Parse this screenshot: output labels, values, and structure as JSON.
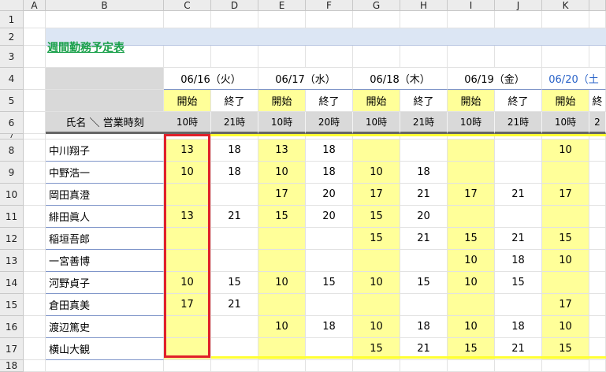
{
  "columns": [
    "A",
    "B",
    "C",
    "D",
    "E",
    "F",
    "G",
    "H",
    "I",
    "J",
    "K",
    ""
  ],
  "rows": [
    "1",
    "2",
    "3",
    "4",
    "5",
    "6",
    "7",
    "8",
    "9",
    "10",
    "11",
    "12",
    "13",
    "14",
    "15",
    "16",
    "17",
    "18"
  ],
  "title": "週間勤務予定表",
  "header": {
    "name_label": "氏名 ＼ 営業時刻",
    "dates": [
      {
        "label": "06/16（火）"
      },
      {
        "label": "06/17（水）"
      },
      {
        "label": "06/18（木）"
      },
      {
        "label": "06/19（金）"
      },
      {
        "label": "06/20（土"
      }
    ],
    "subheaders": [
      "開始",
      "終了",
      "開始",
      "終了",
      "開始",
      "終了",
      "開始",
      "終了",
      "開始",
      "終"
    ],
    "business_hours": [
      "10時",
      "21時",
      "10時",
      "20時",
      "10時",
      "21時",
      "10時",
      "21時",
      "10時",
      "2"
    ]
  },
  "employees": [
    {
      "name": "中川翔子",
      "values": [
        "13",
        "18",
        "13",
        "18",
        "",
        "",
        "",
        "",
        "10"
      ]
    },
    {
      "name": "中野浩一",
      "values": [
        "10",
        "18",
        "10",
        "18",
        "10",
        "18",
        "",
        "",
        "",
        ""
      ]
    },
    {
      "name": "岡田真澄",
      "values": [
        "",
        "",
        "17",
        "20",
        "17",
        "21",
        "17",
        "21",
        "17"
      ]
    },
    {
      "name": "緋田眞人",
      "values": [
        "13",
        "21",
        "15",
        "20",
        "15",
        "20",
        "",
        "",
        ""
      ]
    },
    {
      "name": "稲垣吾郎",
      "values": [
        "",
        "",
        "",
        "",
        "15",
        "21",
        "15",
        "21",
        "15"
      ]
    },
    {
      "name": "一宮善博",
      "values": [
        "",
        "",
        "",
        "",
        "",
        "",
        "10",
        "18",
        "10"
      ]
    },
    {
      "name": "河野貞子",
      "values": [
        "10",
        "15",
        "10",
        "15",
        "10",
        "15",
        "10",
        "15",
        ""
      ]
    },
    {
      "name": "倉田真美",
      "values": [
        "17",
        "21",
        "",
        "",
        "",
        "",
        "",
        "",
        "17"
      ]
    },
    {
      "name": "渡辺篤史",
      "values": [
        "",
        "",
        "10",
        "18",
        "10",
        "18",
        "10",
        "18",
        "10"
      ]
    },
    {
      "name": "横山大観",
      "values": [
        "",
        "",
        "",
        "",
        "15",
        "21",
        "15",
        "21",
        "15"
      ]
    }
  ],
  "colors": {
    "start_column": "#ffff99",
    "header_gray": "#d9d9d9",
    "title_band": "#dce6f4",
    "title_text": "#19a04a",
    "highlight": "#e0202a"
  }
}
